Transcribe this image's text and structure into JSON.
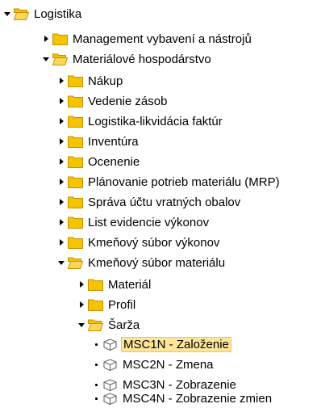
{
  "tree": {
    "logistika": "Logistika",
    "management": "Management vybavení a nástrojů",
    "materialove_hospodarstvo": "Materiálové hospodárstvo",
    "nakup": "Nákup",
    "vedenie_zasob": "Vedenie zásob",
    "logistika_likvidacia": "Logistika-likvidácia faktúr",
    "inventura": "Inventúra",
    "ocenenie": "Ocenenie",
    "mrp": "Plánovanie potrieb materiálu (MRP)",
    "sprava_uctu": "Správa účtu vratných obalov",
    "list_evidencie": "List evidencie výkonov",
    "kmenovy_subor_vykonov": "Kmeňový súbor výkonov",
    "kmenovy_subor_materialu": "Kmeňový súbor materiálu",
    "material": "Materiál",
    "profil": "Profil",
    "sarza": "Šarža",
    "transactions": [
      {
        "label": "MSC1N - Založenie",
        "selected": true
      },
      {
        "label": "MSC2N - Zmena",
        "selected": false
      },
      {
        "label": "MSC3N - Zobrazenie",
        "selected": false
      },
      {
        "label": "MSC4N - Zobrazenie zmien",
        "selected": false
      }
    ]
  },
  "colors": {
    "folder_fill": "#f5c400",
    "folder_open_fill": "#fad75a",
    "folder_stroke": "#c98f00",
    "selection_bg": "#fce598"
  },
  "icons": {
    "folder_closed": "folder-icon",
    "folder_open": "folder-open-icon",
    "transaction": "transaction-cube-icon",
    "collapsed": "triangle-right-icon",
    "expanded": "triangle-down-icon"
  }
}
